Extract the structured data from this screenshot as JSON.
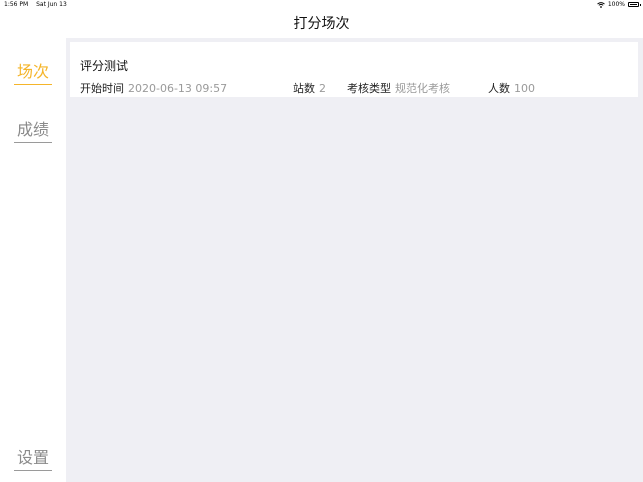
{
  "status_bar": {
    "time": "1:56 PM",
    "date": "Sat Jun 13",
    "battery": "100%",
    "wifi_icon": "wifi-icon",
    "battery_icon": "battery-icon"
  },
  "nav": {
    "title": "打分场次"
  },
  "sidebar": {
    "items": [
      {
        "label": "场次",
        "active": true
      },
      {
        "label": "成绩",
        "active": false
      },
      {
        "label": "设置",
        "active": false
      }
    ]
  },
  "sessions": [
    {
      "name": "评分测试",
      "start_label": "开始时间",
      "start_value": "2020-06-13 09:57",
      "stations_label": "站数",
      "stations_value": "2",
      "type_label": "考核类型",
      "type_value": "规范化考核",
      "people_label": "人数",
      "people_value": "100"
    }
  ],
  "colors": {
    "accent": "#f5b52a",
    "content_bg": "#efeff4",
    "muted_text": "#9a9a9a"
  }
}
